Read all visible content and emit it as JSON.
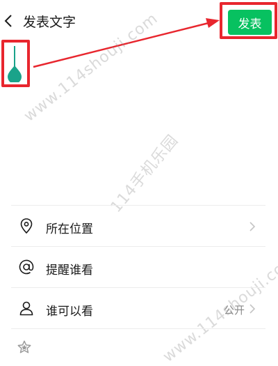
{
  "header": {
    "title": "发表文字",
    "publish_label": "发表"
  },
  "options": [
    {
      "label": "所在位置",
      "icon": "location-pin-icon",
      "value": ""
    },
    {
      "label": "提醒谁看",
      "icon": "at-sign-icon",
      "value": ""
    },
    {
      "label": "谁可以看",
      "icon": "person-icon",
      "value": "公开"
    }
  ],
  "watermarks": [
    "www.114shouji.com",
    "114手机乐园",
    "www.114shouji.com"
  ],
  "colors": {
    "accent": "#07c160",
    "highlight": "#e8262e",
    "cursor": "#1aa38a"
  }
}
